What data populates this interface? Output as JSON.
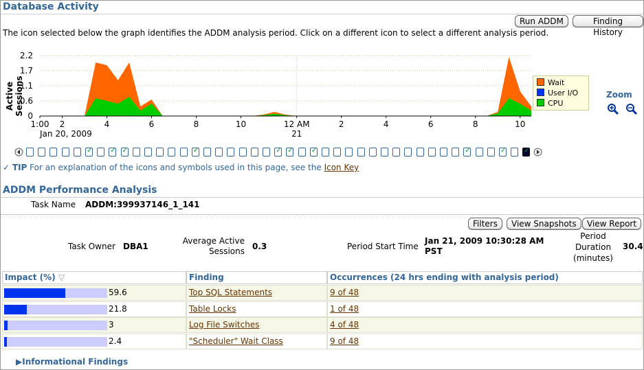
{
  "page_title": "Database Activity",
  "buttons": {
    "run_addm": "Run ADDM",
    "finding_history": "Finding History",
    "filters": "Filters",
    "view_snapshots": "View Snapshots",
    "view_report": "View Report"
  },
  "instructions": "The icon selected below the graph identifies the ADDM analysis period. Click on a different icon to select a different analysis period.",
  "chart_data": {
    "type": "area",
    "ylabel": "Active Sessions",
    "ylim": [
      0,
      2.2
    ],
    "yticks": [
      "2.2",
      "1.7",
      "1.1",
      "0.6",
      "0"
    ],
    "xticks": [
      "1:00",
      "2",
      "4",
      "6",
      "8",
      "10",
      "12 AM",
      "2",
      "4",
      "6",
      "8",
      "10"
    ],
    "xtick_sub": [
      "Jan 20, 2009",
      "21"
    ],
    "x_hours": [
      1,
      1.5,
      2,
      2.5,
      3,
      3.5,
      4,
      4.5,
      5,
      5.5,
      6,
      6.5,
      7,
      7.5,
      8,
      8.5,
      9,
      9.5,
      10,
      10.5,
      11,
      11.5,
      12,
      12.5,
      13,
      13.5,
      14,
      14.5,
      15,
      15.5,
      16,
      16.5,
      17,
      17.5,
      18,
      18.5,
      19,
      19.5,
      20,
      20.5,
      21,
      21.5,
      22,
      22.5,
      23
    ],
    "series": [
      {
        "name": "Wait",
        "color": "#ff6600",
        "values": [
          0,
          0,
          0,
          0,
          0,
          1.95,
          1.85,
          1.3,
          1.95,
          0.35,
          0.6,
          0,
          0,
          0,
          0,
          0,
          0,
          0,
          0,
          0,
          0.05,
          0.15,
          0.05,
          0,
          0,
          0,
          0,
          0,
          0,
          0,
          0,
          0,
          0,
          0,
          0,
          0,
          0,
          0,
          0,
          0,
          0,
          0.15,
          2.15,
          0.9,
          0.35
        ]
      },
      {
        "name": "User I/O",
        "color": "#0033ff",
        "values": [
          0,
          0,
          0,
          0,
          0,
          0,
          0,
          0,
          0,
          0,
          0,
          0,
          0,
          0,
          0,
          0,
          0,
          0,
          0,
          0,
          0,
          0,
          0,
          0,
          0,
          0,
          0,
          0,
          0,
          0,
          0,
          0,
          0,
          0,
          0,
          0,
          0,
          0,
          0,
          0,
          0,
          0,
          0,
          0,
          0
        ]
      },
      {
        "name": "CPU",
        "color": "#00cc00",
        "values": [
          0,
          0,
          0,
          0,
          0,
          0.65,
          0.55,
          0.45,
          0.7,
          0.2,
          0.45,
          0,
          0,
          0,
          0,
          0,
          0,
          0,
          0,
          0,
          0.03,
          0.08,
          0.03,
          0,
          0,
          0,
          0,
          0,
          0,
          0,
          0,
          0,
          0,
          0,
          0,
          0,
          0,
          0,
          0,
          0,
          0,
          0.1,
          0.65,
          0.45,
          0.2
        ]
      }
    ],
    "legend": "right",
    "grid": true
  },
  "zoom": {
    "label": "Zoom"
  },
  "tip": {
    "label": "TIP",
    "text": "For an explanation of the icons and symbols used in this page, see the",
    "link": "Icon Key"
  },
  "addm": {
    "section_title": "ADDM Performance Analysis",
    "task_name_label": "Task Name",
    "task_name": "ADDM:399937146_1_141",
    "task_owner_label": "Task Owner",
    "task_owner": "DBA1",
    "avg_sessions_label_1": "Average Active",
    "avg_sessions_label_2": "Sessions",
    "avg_sessions": "0.3",
    "period_start_label": "Period Start Time",
    "period_start_1": "Jan 21, 2009 10:30:28 AM",
    "period_start_2": "PST",
    "period_duration_label_1": "Period",
    "period_duration_label_2": "Duration",
    "period_duration_label_3": "(minutes)",
    "period_duration": "30.4"
  },
  "findings_table": {
    "headers": [
      "Impact (%)",
      "Finding",
      "Occurrences (24 hrs ending with analysis period)"
    ],
    "rows": [
      {
        "impact": "59.6",
        "impact_pct": 59.6,
        "finding": "Top SQL Statements",
        "occurrences": "9 of 48"
      },
      {
        "impact": "21.8",
        "impact_pct": 21.8,
        "finding": "Table Locks",
        "occurrences": "1 of 48"
      },
      {
        "impact": "3",
        "impact_pct": 3,
        "finding": "Log File Switches",
        "occurrences": "4 of 48"
      },
      {
        "impact": "2.4",
        "impact_pct": 2.4,
        "finding": "\"Scheduler\" Wait Class",
        "occurrences": "9 of 48"
      }
    ]
  },
  "informational_findings": "Informational Findings"
}
